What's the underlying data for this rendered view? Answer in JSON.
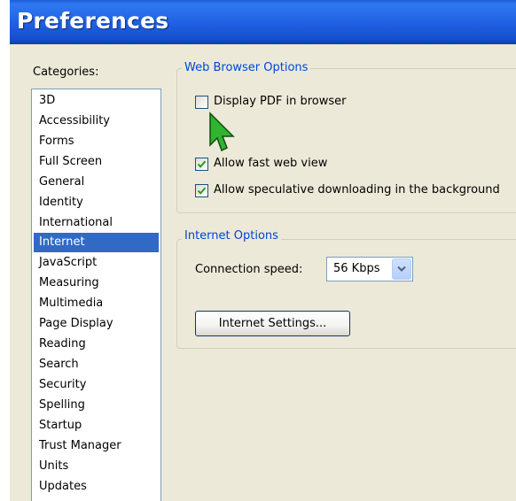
{
  "window": {
    "title": "Preferences"
  },
  "categories": {
    "label": "Categories:",
    "selected": "Internet",
    "items": [
      "3D",
      "Accessibility",
      "Forms",
      "Full Screen",
      "General",
      "Identity",
      "International",
      "Internet",
      "JavaScript",
      "Measuring",
      "Multimedia",
      "Page Display",
      "Reading",
      "Search",
      "Security",
      "Spelling",
      "Startup",
      "Trust Manager",
      "Units",
      "Updates"
    ]
  },
  "web_browser_options": {
    "title": "Web Browser Options",
    "display_pdf_in_browser": {
      "label": "Display PDF in browser",
      "checked": false
    },
    "allow_fast_web_view": {
      "label": "Allow fast web view",
      "checked": true
    },
    "allow_speculative_downloading": {
      "label": "Allow speculative downloading in the background",
      "checked": true
    }
  },
  "internet_options": {
    "title": "Internet Options",
    "connection_speed_label": "Connection speed:",
    "connection_speed_value": "56 Kbps",
    "internet_settings_button": "Internet Settings..."
  },
  "colors": {
    "titlebar": "#1f5fe0",
    "selection": "#316ac5",
    "group_title": "#0046d5",
    "check": "#21a121",
    "cursor": "#2fb52f"
  }
}
